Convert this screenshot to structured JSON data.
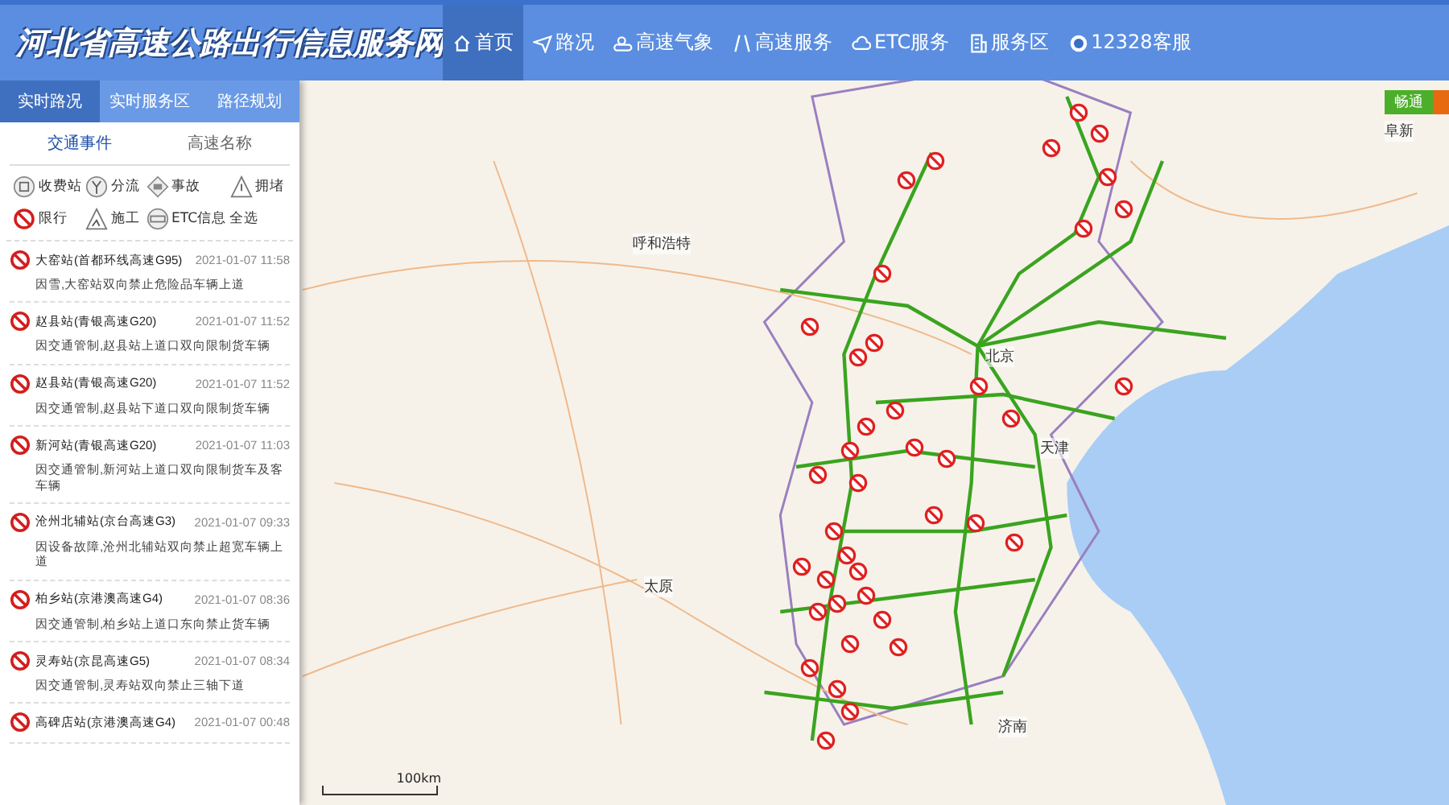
{
  "header": {
    "logo": "河北省高速公路出行信息服务网"
  },
  "nav": [
    {
      "label": "首页",
      "selected": true
    },
    {
      "label": "路况",
      "selected": false
    },
    {
      "label": "高速气象",
      "selected": false
    },
    {
      "label": "高速服务",
      "selected": false
    },
    {
      "label": "ETC服务",
      "selected": false
    },
    {
      "label": "服务区",
      "selected": false
    },
    {
      "label": "12328客服",
      "selected": false
    }
  ],
  "sidebar": {
    "tabs": [
      {
        "label": "实时路况",
        "selected": true
      },
      {
        "label": "实时服务区",
        "selected": false
      },
      {
        "label": "路径规划",
        "selected": false
      }
    ],
    "subtabs": [
      {
        "label": "交通事件",
        "selected": true
      },
      {
        "label": "高速名称",
        "selected": false
      }
    ],
    "filters": [
      {
        "label": "收费站",
        "kind": "toll"
      },
      {
        "label": "分流",
        "kind": "split"
      },
      {
        "label": "事故",
        "kind": "accident"
      },
      {
        "label": "拥堵",
        "kind": "jam"
      },
      {
        "label": "限行",
        "kind": "ban"
      },
      {
        "label": "施工",
        "kind": "work"
      },
      {
        "label": "ETC信息",
        "kind": "etc"
      },
      {
        "label": "全选",
        "kind": "all"
      }
    ],
    "events": [
      {
        "title": "大窑站(首都环线高速G95)",
        "time": "2021-01-07 11:58",
        "text": "因雪,大窑站双向禁止危险品车辆上道"
      },
      {
        "title": "赵县站(青银高速G20)",
        "time": "2021-01-07 11:52",
        "text": "因交通管制,赵县站上道口双向限制货车辆"
      },
      {
        "title": "赵县站(青银高速G20)",
        "time": "2021-01-07 11:52",
        "text": "因交通管制,赵县站下道口双向限制货车辆"
      },
      {
        "title": "新河站(青银高速G20)",
        "time": "2021-01-07 11:03",
        "text": "因交通管制,新河站上道口双向限制货车及客车辆"
      },
      {
        "title": "沧州北辅站(京台高速G3)",
        "time": "2021-01-07 09:33",
        "text": "因设备故障,沧州北辅站双向禁止超宽车辆上道"
      },
      {
        "title": "柏乡站(京港澳高速G4)",
        "time": "2021-01-07 08:36",
        "text": "因交通管制,柏乡站上道口东向禁止货车辆"
      },
      {
        "title": "灵寿站(京昆高速G5)",
        "time": "2021-01-07 08:34",
        "text": "因交通管制,灵寿站双向禁止三轴下道"
      },
      {
        "title": "高碑店站(京港澳高速G4)",
        "time": "2021-01-07 00:48"
      }
    ]
  },
  "map": {
    "cities": [
      {
        "name": "呼和浩特"
      },
      {
        "name": "北京"
      },
      {
        "name": "天津"
      },
      {
        "name": "太原"
      },
      {
        "name": "济南"
      },
      {
        "name": "阜新"
      }
    ],
    "legend": [
      {
        "label": "畅通",
        "color": "#4caf2a"
      }
    ],
    "scale": "100km"
  }
}
